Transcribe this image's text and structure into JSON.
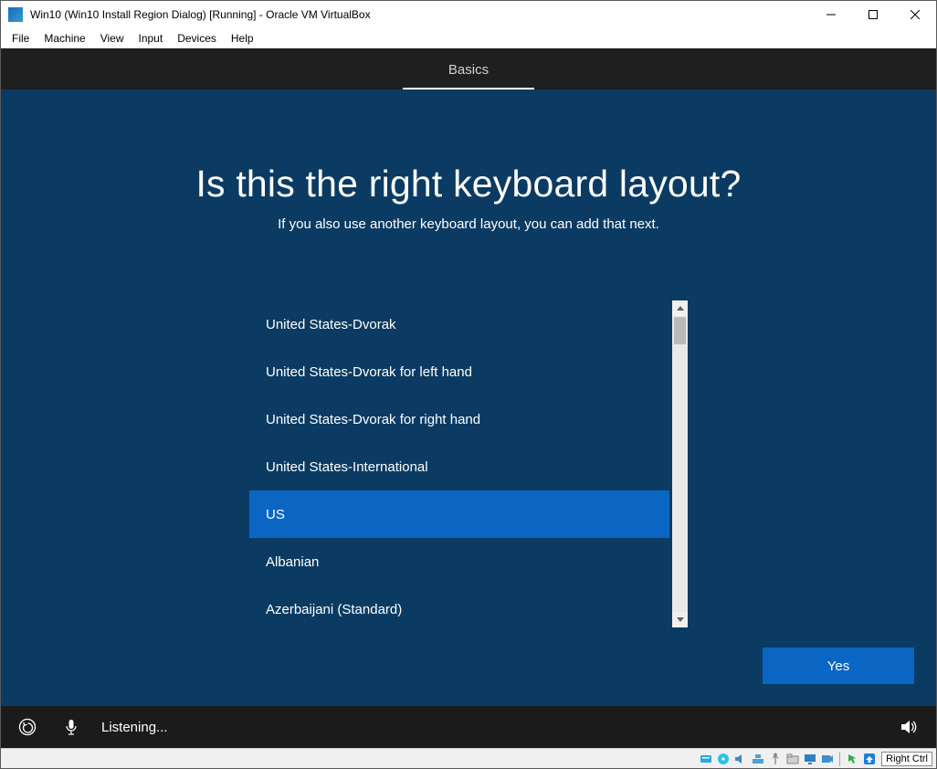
{
  "window": {
    "title": "Win10 (Win10 Install Region Dialog) [Running] - Oracle VM VirtualBox"
  },
  "menubar": {
    "file": "File",
    "machine": "Machine",
    "view": "View",
    "input": "Input",
    "devices": "Devices",
    "help": "Help"
  },
  "tab": {
    "label": "Basics"
  },
  "main": {
    "headline": "Is this the right keyboard layout?",
    "subhead": "If you also use another keyboard layout, you can add that next."
  },
  "list": {
    "selected_index": 4,
    "items": [
      "United States-Dvorak",
      "United States-Dvorak for left hand",
      "United States-Dvorak for right hand",
      "United States-International",
      "US",
      "Albanian",
      "Azerbaijani (Standard)"
    ]
  },
  "yes_button": "Yes",
  "bottom": {
    "listening": "Listening..."
  },
  "status": {
    "host_key": "Right Ctrl"
  }
}
